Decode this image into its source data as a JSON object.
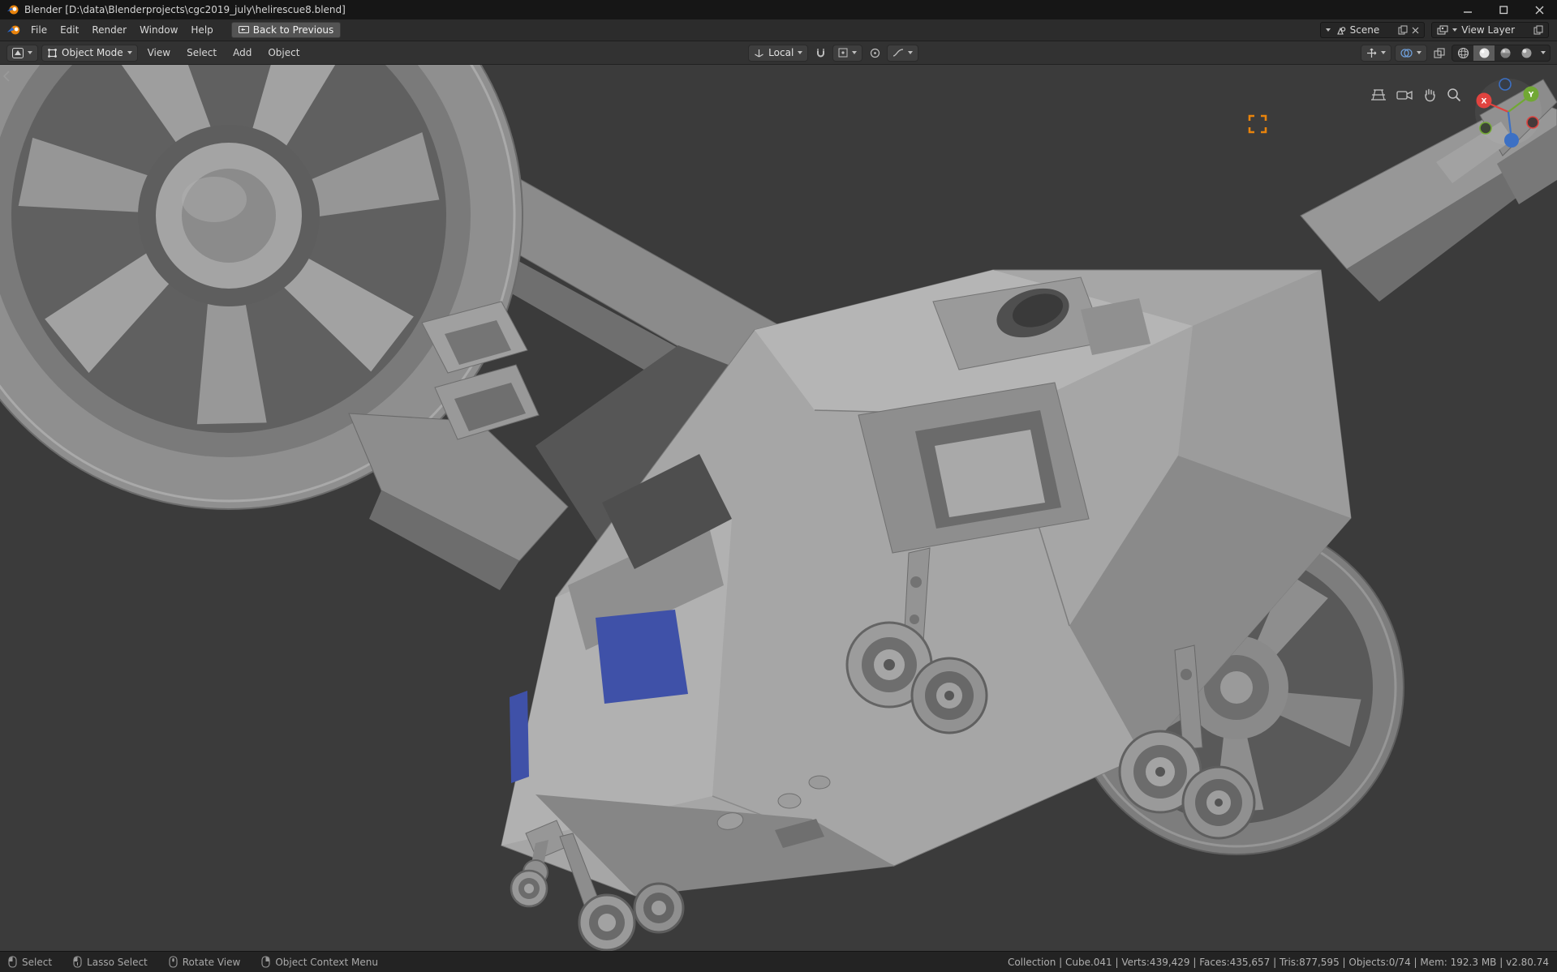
{
  "window": {
    "title": "Blender [D:\\data\\Blenderprojects\\cgc2019_july\\helirescue8.blend]"
  },
  "topbar": {
    "menus": [
      {
        "label": "File"
      },
      {
        "label": "Edit"
      },
      {
        "label": "Render"
      },
      {
        "label": "Window"
      },
      {
        "label": "Help"
      }
    ],
    "back_button": "Back to Previous",
    "scene": {
      "value": "Scene"
    },
    "view_layer": {
      "value": "View Layer"
    }
  },
  "tool_header": {
    "mode": "Object Mode",
    "menus": [
      {
        "label": "View"
      },
      {
        "label": "Select"
      },
      {
        "label": "Add"
      },
      {
        "label": "Object"
      }
    ],
    "orientation": "Local"
  },
  "viewport": {
    "gizmo": {
      "x_label": "X",
      "y_label": "Y"
    }
  },
  "statusbar": {
    "hints": [
      {
        "label": "Select"
      },
      {
        "label": "Lasso Select"
      },
      {
        "label": "Rotate View"
      },
      {
        "label": "Object Context Menu"
      }
    ],
    "stats": "Collection | Cube.041 | Verts:439,429 | Faces:435,657 | Tris:877,595 | Objects:0/74 | Mem: 192.3 MB | v2.80.74"
  },
  "colors": {
    "accent_orange": "#e8830c",
    "axis_x": "#e0433f",
    "axis_y": "#71a834",
    "axis_z": "#3c70c4",
    "window_glass_blue": "#3f51a8"
  }
}
